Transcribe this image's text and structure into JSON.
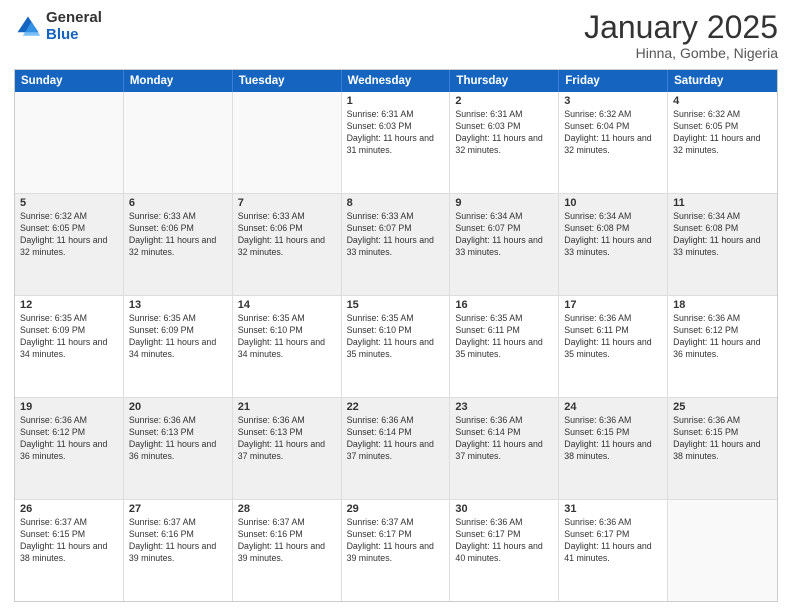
{
  "logo": {
    "general": "General",
    "blue": "Blue"
  },
  "title": {
    "month": "January 2025",
    "location": "Hinna, Gombe, Nigeria"
  },
  "weekdays": [
    "Sunday",
    "Monday",
    "Tuesday",
    "Wednesday",
    "Thursday",
    "Friday",
    "Saturday"
  ],
  "rows": [
    [
      {
        "day": "",
        "text": "",
        "empty": true
      },
      {
        "day": "",
        "text": "",
        "empty": true
      },
      {
        "day": "",
        "text": "",
        "empty": true
      },
      {
        "day": "1",
        "text": "Sunrise: 6:31 AM\nSunset: 6:03 PM\nDaylight: 11 hours and 31 minutes."
      },
      {
        "day": "2",
        "text": "Sunrise: 6:31 AM\nSunset: 6:03 PM\nDaylight: 11 hours and 32 minutes."
      },
      {
        "day": "3",
        "text": "Sunrise: 6:32 AM\nSunset: 6:04 PM\nDaylight: 11 hours and 32 minutes."
      },
      {
        "day": "4",
        "text": "Sunrise: 6:32 AM\nSunset: 6:05 PM\nDaylight: 11 hours and 32 minutes."
      }
    ],
    [
      {
        "day": "5",
        "text": "Sunrise: 6:32 AM\nSunset: 6:05 PM\nDaylight: 11 hours and 32 minutes.",
        "shaded": true
      },
      {
        "day": "6",
        "text": "Sunrise: 6:33 AM\nSunset: 6:06 PM\nDaylight: 11 hours and 32 minutes.",
        "shaded": true
      },
      {
        "day": "7",
        "text": "Sunrise: 6:33 AM\nSunset: 6:06 PM\nDaylight: 11 hours and 32 minutes.",
        "shaded": true
      },
      {
        "day": "8",
        "text": "Sunrise: 6:33 AM\nSunset: 6:07 PM\nDaylight: 11 hours and 33 minutes.",
        "shaded": true
      },
      {
        "day": "9",
        "text": "Sunrise: 6:34 AM\nSunset: 6:07 PM\nDaylight: 11 hours and 33 minutes.",
        "shaded": true
      },
      {
        "day": "10",
        "text": "Sunrise: 6:34 AM\nSunset: 6:08 PM\nDaylight: 11 hours and 33 minutes.",
        "shaded": true
      },
      {
        "day": "11",
        "text": "Sunrise: 6:34 AM\nSunset: 6:08 PM\nDaylight: 11 hours and 33 minutes.",
        "shaded": true
      }
    ],
    [
      {
        "day": "12",
        "text": "Sunrise: 6:35 AM\nSunset: 6:09 PM\nDaylight: 11 hours and 34 minutes."
      },
      {
        "day": "13",
        "text": "Sunrise: 6:35 AM\nSunset: 6:09 PM\nDaylight: 11 hours and 34 minutes."
      },
      {
        "day": "14",
        "text": "Sunrise: 6:35 AM\nSunset: 6:10 PM\nDaylight: 11 hours and 34 minutes."
      },
      {
        "day": "15",
        "text": "Sunrise: 6:35 AM\nSunset: 6:10 PM\nDaylight: 11 hours and 35 minutes."
      },
      {
        "day": "16",
        "text": "Sunrise: 6:35 AM\nSunset: 6:11 PM\nDaylight: 11 hours and 35 minutes."
      },
      {
        "day": "17",
        "text": "Sunrise: 6:36 AM\nSunset: 6:11 PM\nDaylight: 11 hours and 35 minutes."
      },
      {
        "day": "18",
        "text": "Sunrise: 6:36 AM\nSunset: 6:12 PM\nDaylight: 11 hours and 36 minutes."
      }
    ],
    [
      {
        "day": "19",
        "text": "Sunrise: 6:36 AM\nSunset: 6:12 PM\nDaylight: 11 hours and 36 minutes.",
        "shaded": true
      },
      {
        "day": "20",
        "text": "Sunrise: 6:36 AM\nSunset: 6:13 PM\nDaylight: 11 hours and 36 minutes.",
        "shaded": true
      },
      {
        "day": "21",
        "text": "Sunrise: 6:36 AM\nSunset: 6:13 PM\nDaylight: 11 hours and 37 minutes.",
        "shaded": true
      },
      {
        "day": "22",
        "text": "Sunrise: 6:36 AM\nSunset: 6:14 PM\nDaylight: 11 hours and 37 minutes.",
        "shaded": true
      },
      {
        "day": "23",
        "text": "Sunrise: 6:36 AM\nSunset: 6:14 PM\nDaylight: 11 hours and 37 minutes.",
        "shaded": true
      },
      {
        "day": "24",
        "text": "Sunrise: 6:36 AM\nSunset: 6:15 PM\nDaylight: 11 hours and 38 minutes.",
        "shaded": true
      },
      {
        "day": "25",
        "text": "Sunrise: 6:36 AM\nSunset: 6:15 PM\nDaylight: 11 hours and 38 minutes.",
        "shaded": true
      }
    ],
    [
      {
        "day": "26",
        "text": "Sunrise: 6:37 AM\nSunset: 6:15 PM\nDaylight: 11 hours and 38 minutes."
      },
      {
        "day": "27",
        "text": "Sunrise: 6:37 AM\nSunset: 6:16 PM\nDaylight: 11 hours and 39 minutes."
      },
      {
        "day": "28",
        "text": "Sunrise: 6:37 AM\nSunset: 6:16 PM\nDaylight: 11 hours and 39 minutes."
      },
      {
        "day": "29",
        "text": "Sunrise: 6:37 AM\nSunset: 6:17 PM\nDaylight: 11 hours and 39 minutes."
      },
      {
        "day": "30",
        "text": "Sunrise: 6:36 AM\nSunset: 6:17 PM\nDaylight: 11 hours and 40 minutes."
      },
      {
        "day": "31",
        "text": "Sunrise: 6:36 AM\nSunset: 6:17 PM\nDaylight: 11 hours and 41 minutes."
      },
      {
        "day": "",
        "text": "",
        "empty": true
      }
    ]
  ]
}
